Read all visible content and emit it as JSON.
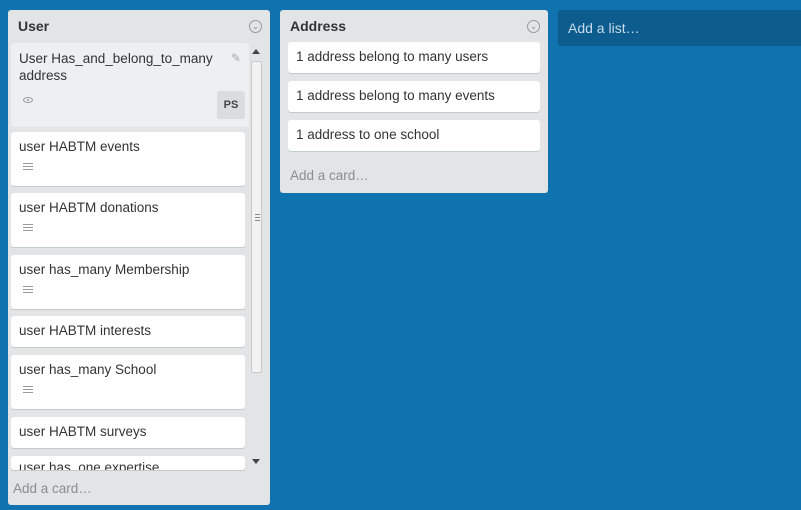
{
  "lists": [
    {
      "title": "User",
      "cards": [
        {
          "text": "User Has_and_belong_to_many address",
          "avatar": "PS"
        },
        {
          "text": "user HABTM events"
        },
        {
          "text": "user HABTM donations"
        },
        {
          "text": "user has_many Membership"
        },
        {
          "text": "user HABTM interests"
        },
        {
          "text": "user has_many School"
        },
        {
          "text": "user HABTM surveys"
        },
        {
          "text": "user has_one expertise"
        }
      ],
      "add_card": "Add a card…"
    },
    {
      "title": "Address",
      "cards": [
        {
          "text": "1 address belong to many users"
        },
        {
          "text": "1 address belong to many events"
        },
        {
          "text": "1 address to one school"
        }
      ],
      "add_card": "Add a card…"
    }
  ],
  "add_list": "Add a list…",
  "icons": {
    "list_menu": "chevron-down-icon",
    "description": "description-icon",
    "watch": "eye-icon",
    "edit": "pencil-icon"
  },
  "colors": {
    "board_bg": "#1172b0",
    "list_bg": "#e2e4e6",
    "card_bg": "#ffffff"
  }
}
